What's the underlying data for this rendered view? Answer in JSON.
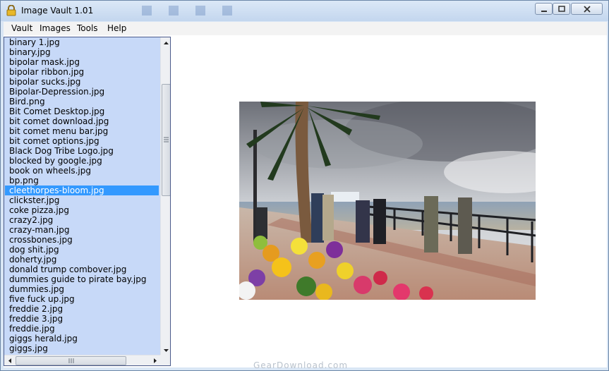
{
  "window": {
    "title": "Image Vault 1.01"
  },
  "menu": [
    "Vault",
    "Images",
    "Tools",
    "Help"
  ],
  "files": [
    "binary 1.jpg",
    "binary.jpg",
    "bipolar mask.jpg",
    "bipolar ribbon.jpg",
    "bipolar sucks.jpg",
    "Bipolar-Depression.jpg",
    "Bird.png",
    "Bit Comet Desktop.jpg",
    "bit comet download.jpg",
    "bit comet menu bar.jpg",
    "bit comet options.jpg",
    "Black Dog Tribe Logo.jpg",
    "blocked by google.jpg",
    "book on wheels.jpg",
    "bp.png",
    "cleethorpes-bloom.jpg",
    "clickster.jpg",
    "coke pizza.jpg",
    "crazy2.jpg",
    "crazy-man.jpg",
    "crossbones.jpg",
    "dog shit.jpg",
    "doherty.jpg",
    "donald trump combover.jpg",
    "dummies guide to pirate bay.jpg",
    "dummies.jpg",
    "five fuck up.jpg",
    "freddie 2.jpg",
    "freddie 3.jpg",
    "freddie.jpg",
    "giggs herald.jpg",
    "giggs.jpg"
  ],
  "selected_file": "cleethorpes-bloom.jpg",
  "watermark": "GearDownload.com",
  "icons": {
    "app": "padlock-icon",
    "minimize": "minimize-icon",
    "maximize": "maximize-icon",
    "close": "close-icon"
  },
  "colors": {
    "selection": "#3399ff",
    "list_bg": "#c7d9f8"
  }
}
